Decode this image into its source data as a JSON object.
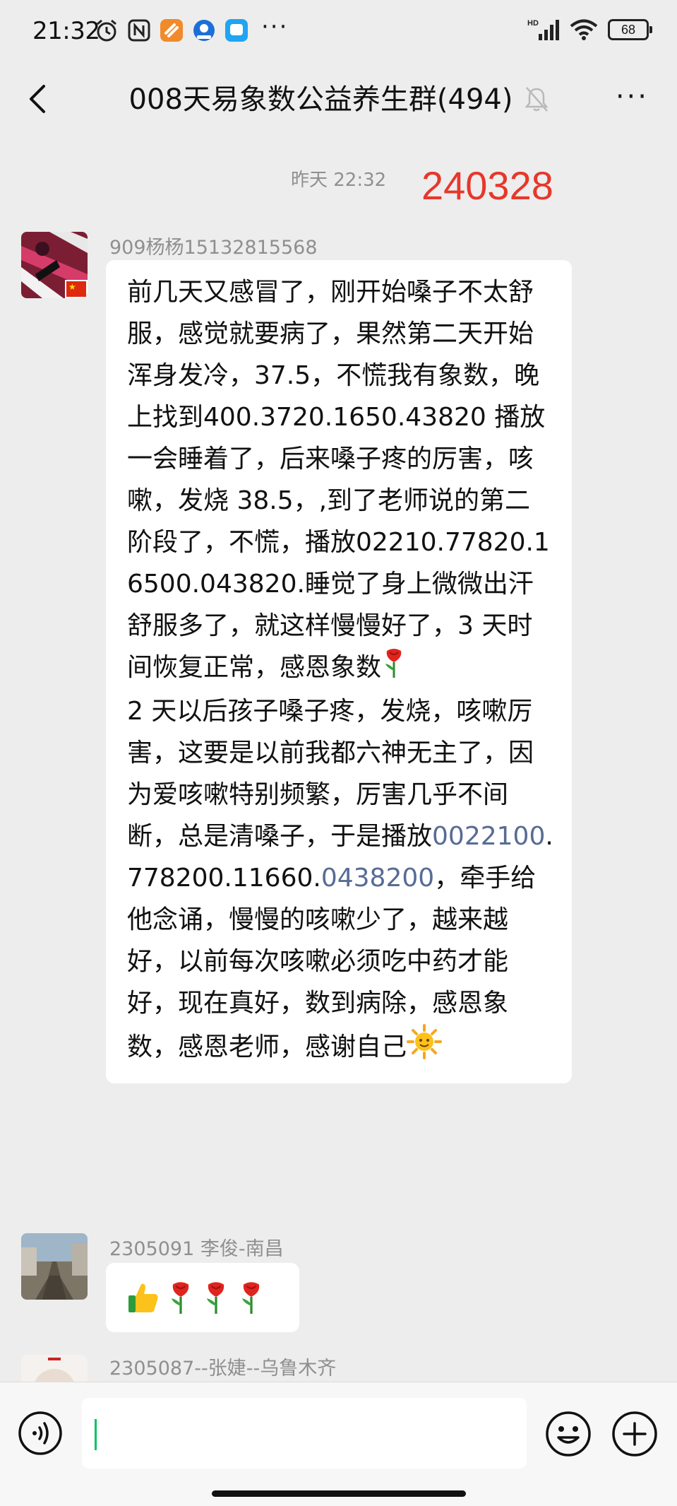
{
  "status_bar": {
    "time": "21:32",
    "network": "HD",
    "battery": "68"
  },
  "nav": {
    "title": "008天易象数公益养生群(494)"
  },
  "chat": {
    "timestamp": "昨天 22:32",
    "date_annotation": "240328",
    "messages": [
      {
        "sender": "909杨杨15132815568",
        "text_segments": [
          {
            "text": "前几天又感冒了，刚开始嗓子不太舒服，感觉就要病了，果然第二天开始浑身发冷，37.5，不慌我有象数，晚上找到400.3720.1650.43820 播放一会睡着了，后来嗓子疼的厉害，咳嗽，发烧 38.5，,到了老师说的第二阶段了，不慌，播放02210.77820.16500.043820.睡觉了身上微微出汗舒服多了，就这样慢慢好了，3 天时间恢复正常，感恩象数"
          },
          {
            "text": "2 天以后孩子嗓子疼，发烧，咳嗽厉害，这要是以前我都六神无主了，因为爱咳嗽特别频繁，厉害几乎不间断，总是清嗓子，于是播放"
          },
          {
            "link1": "0022100"
          },
          {
            "text": ".778200.11660."
          },
          {
            "link2": "0438200"
          },
          {
            "text": "，牵手给他念诵，慢慢的咳嗽少了，越来越好，以前每次咳嗽必须吃中药才能好，现在真好，数到病除，感恩象数，感恩老师，感谢自己"
          }
        ]
      },
      {
        "sender": "2305091 李俊-南昌",
        "emojis": [
          "thumbs-up",
          "rose",
          "rose",
          "rose"
        ]
      },
      {
        "sender": "2305087--张婕--乌鲁木齐"
      }
    ]
  },
  "colors": {
    "background": "#ededed",
    "bubble": "#ffffff",
    "accent_red": "#e7372b",
    "link": "#576b95",
    "caret": "#07c160"
  }
}
